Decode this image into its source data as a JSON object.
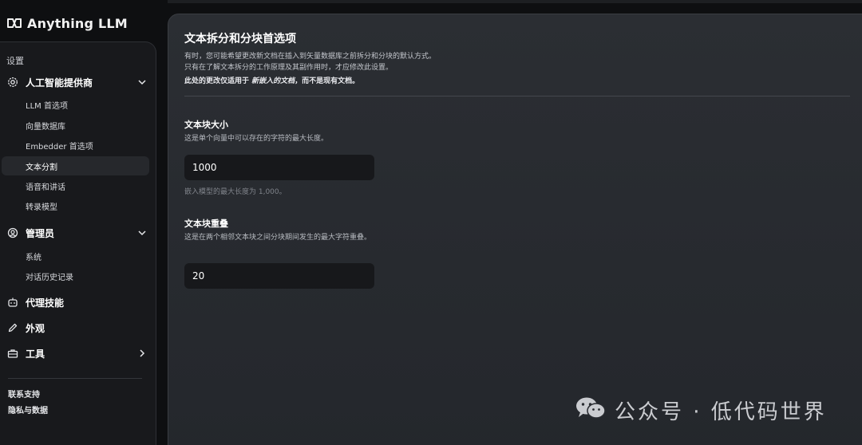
{
  "app": {
    "logo_text": "Anything LLM"
  },
  "sidebar": {
    "section_label": "设置",
    "groups": [
      {
        "label": "人工智能提供商",
        "icon": "gear-icon",
        "expanded": true
      },
      {
        "label": "管理员",
        "icon": "admin-icon",
        "expanded": true
      },
      {
        "label": "代理技能",
        "icon": "robot-icon"
      },
      {
        "label": "外观",
        "icon": "pen-icon"
      },
      {
        "label": "工具",
        "icon": "toolbox-icon",
        "expanded": false
      }
    ],
    "ai_items": [
      "LLM 首选项",
      "向量数据库",
      "Embedder 首选项",
      "文本分割",
      "语音和讲话",
      "转录模型"
    ],
    "admin_items": [
      "系统",
      "对话历史记录"
    ],
    "active_item": "文本分割",
    "footer": {
      "support": "联系支持",
      "privacy": "隐私与数据"
    }
  },
  "main": {
    "title": "文本拆分和分块首选项",
    "desc_line1": "有时，您可能希望更改新文档在插入到矢量数据库之前拆分和分块的默认方式。",
    "desc_line2": "只有在了解文本拆分的工作原理及其副作用时，才应修改此设置。",
    "desc_note_prefix": "此处的更改仅适用于 ",
    "desc_note_em": "新嵌入的文档",
    "desc_note_suffix": "，而不是现有文档。",
    "chunk_size": {
      "label": "文本块大小",
      "help": "这是单个向量中可以存在的字符的最大长度。",
      "value": "1000",
      "hint": "嵌入模型的最大长度为 1,000。"
    },
    "chunk_overlap": {
      "label": "文本块重叠",
      "help": "这是在两个相邻文本块之间分块期间发生的最大字符重叠。",
      "value": "20"
    }
  },
  "watermark": {
    "text": "公众号 · 低代码世界"
  }
}
